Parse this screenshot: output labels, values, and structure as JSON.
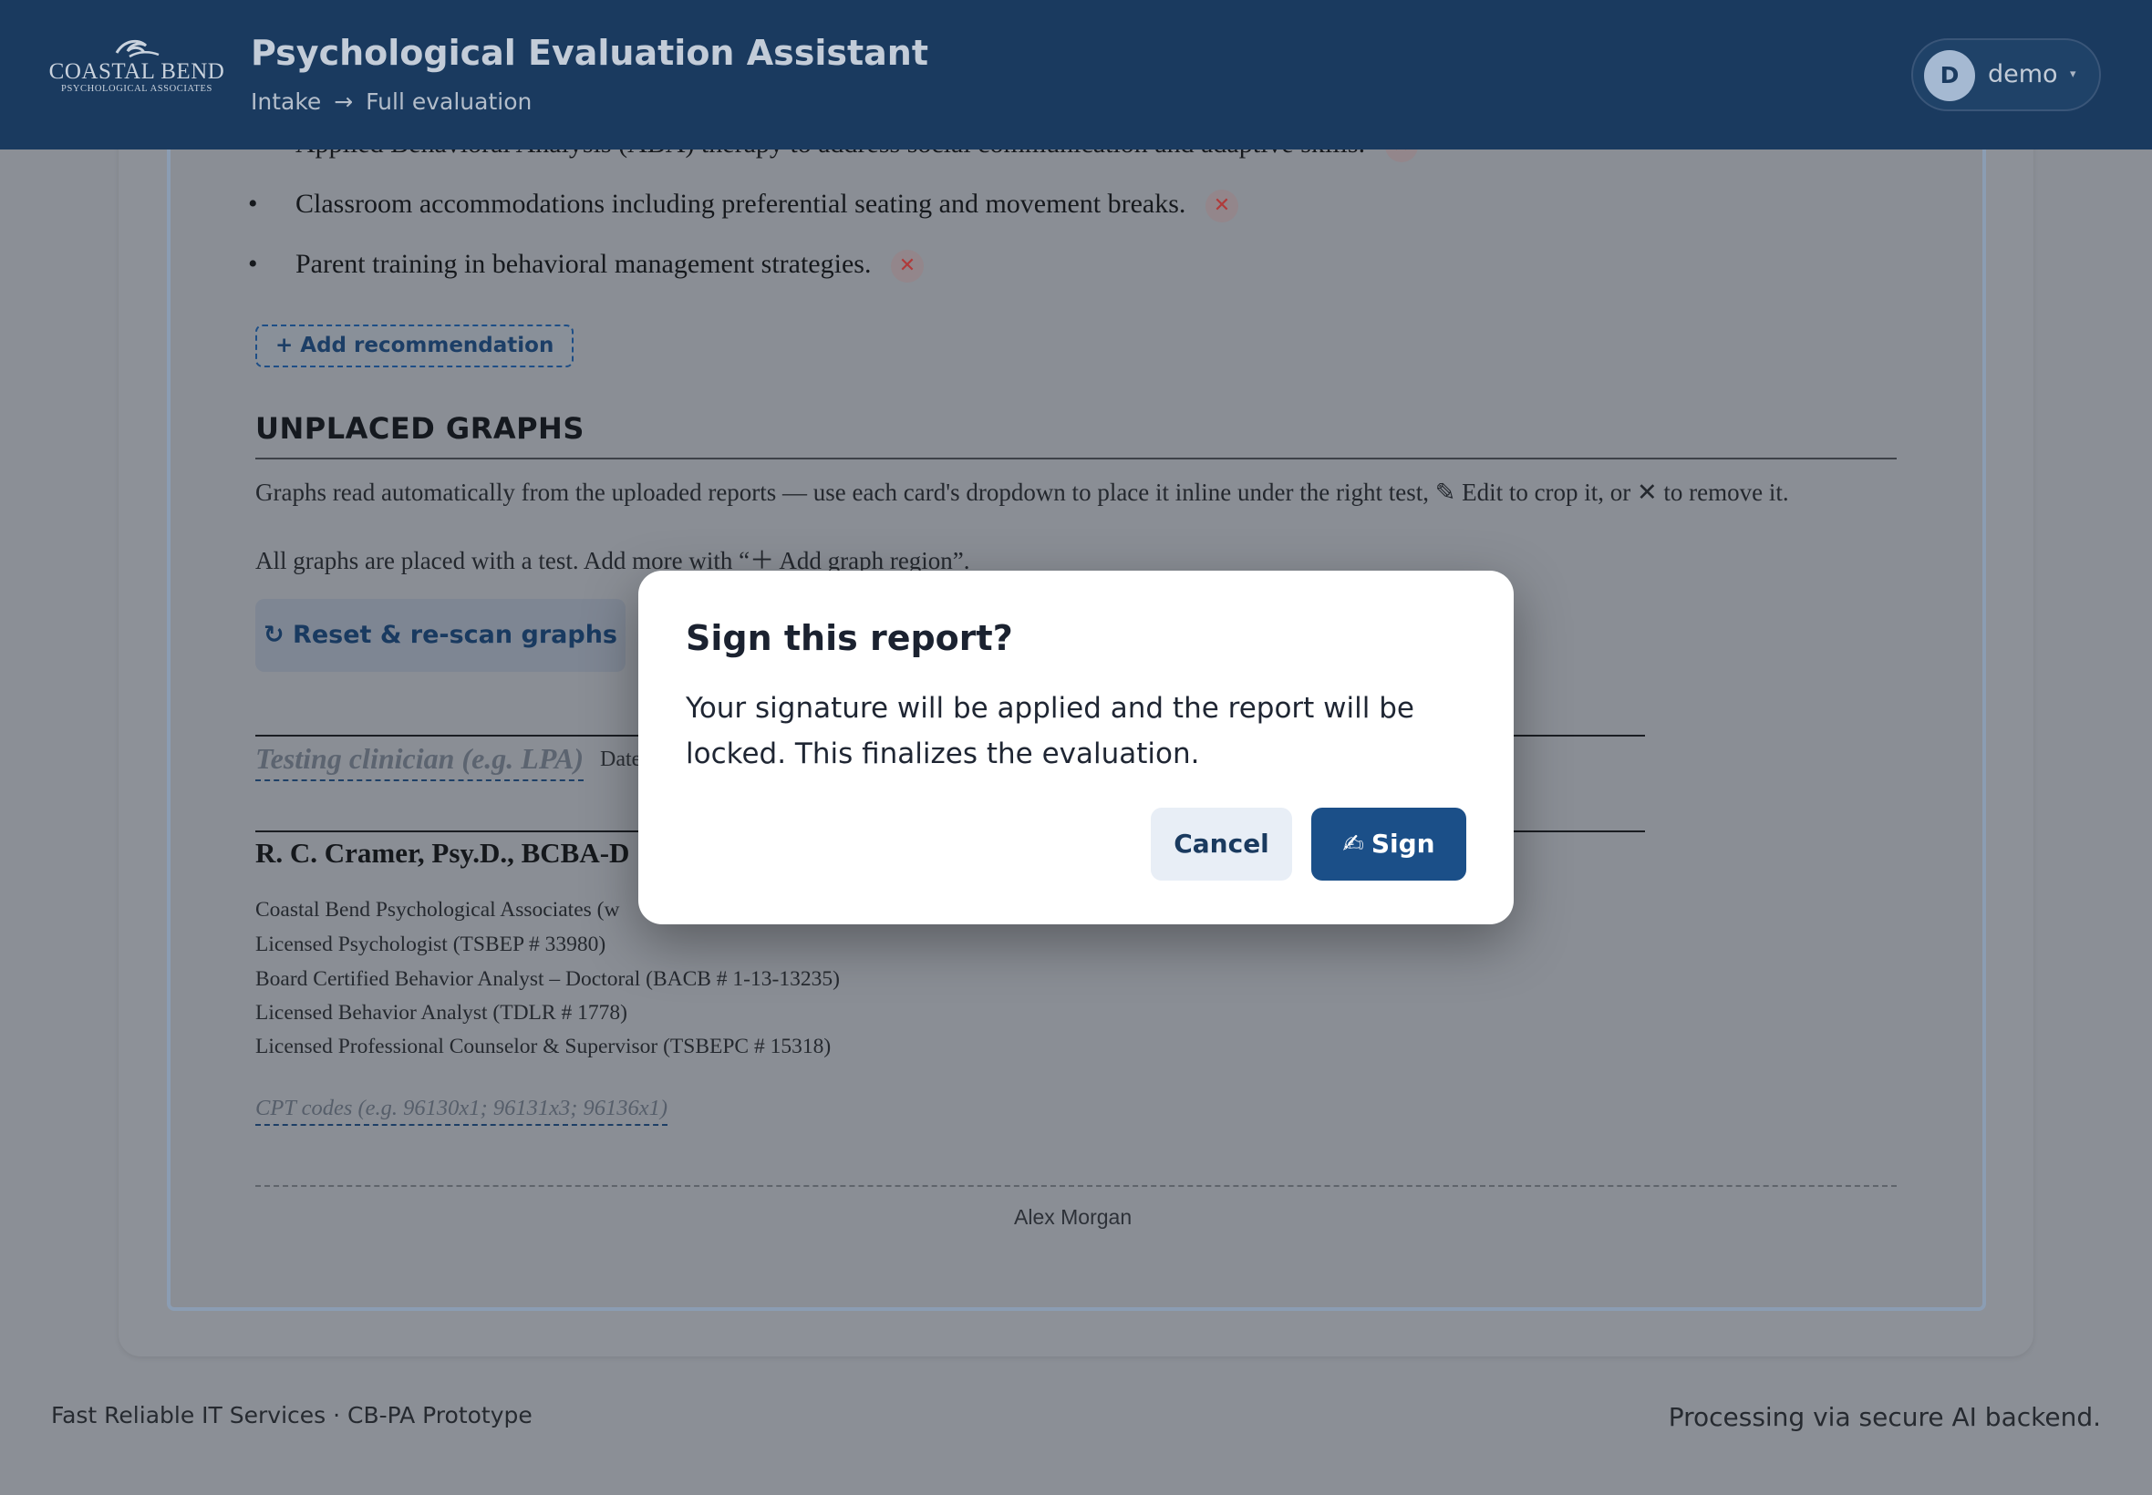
{
  "header": {
    "logo_name": "COASTAL BEND",
    "logo_sub": "PSYCHOLOGICAL ASSOCIATES",
    "app_title": "Psychological Evaluation Assistant",
    "breadcrumb": {
      "from": "Intake",
      "arrow": "→",
      "to": "Full evaluation"
    },
    "user": {
      "initial": "D",
      "name": "demo",
      "caret": "▾"
    }
  },
  "recommendations": {
    "items": [
      "Applied Behavioral Analysis (ABA) therapy to address social communication and adaptive skills.",
      "Classroom accommodations including preferential seating and movement breaks.",
      "Parent training in behavioral management strategies."
    ],
    "remove_glyph": "✕",
    "bullet": "•",
    "add_label": "+ Add recommendation"
  },
  "graphs": {
    "title": "UNPLACED GRAPHS",
    "help": "Graphs read automatically from the uploaded reports — use each card's dropdown to place it inline under the right test, ✎ Edit to crop it, or ✕ to remove it.",
    "status": "All graphs are placed with a test. Add more with “＋ Add graph region”.",
    "reset_label": "↻ Reset & re-scan graphs"
  },
  "signature": {
    "clinician_placeholder": "Testing clinician (e.g. LPA)",
    "date_label": "Date",
    "signer": "R. C. Cramer, Psy.D., BCBA-D",
    "credentials": [
      "Coastal Bend Psychological Associates (w",
      "Licensed Psychologist (TSBEP # 33980)",
      "Board Certified Behavior Analyst – Doctoral (BACB # 1-13-13235)",
      "Licensed Behavior Analyst (TDLR # 1778)",
      "Licensed Professional Counselor & Supervisor (TSBEPC # 15318)"
    ],
    "cpt_placeholder": "CPT codes (e.g. 96130x1; 96131x3; 96136x1)",
    "patient_name": "Alex Morgan"
  },
  "footer": {
    "left": "Fast Reliable IT Services · CB-PA Prototype",
    "right": "Processing via secure AI backend."
  },
  "modal": {
    "title": "Sign this report?",
    "body": "Your signature will be applied and the report will be locked. This finalizes the evaluation.",
    "cancel_label": "Cancel",
    "sign_icon": "✍",
    "sign_label": "Sign"
  },
  "colors": {
    "header_bg": "#1a3a5f",
    "primary": "#1b4f88",
    "overlay_bg": "#8b8f96",
    "danger": "#b03a3a"
  }
}
